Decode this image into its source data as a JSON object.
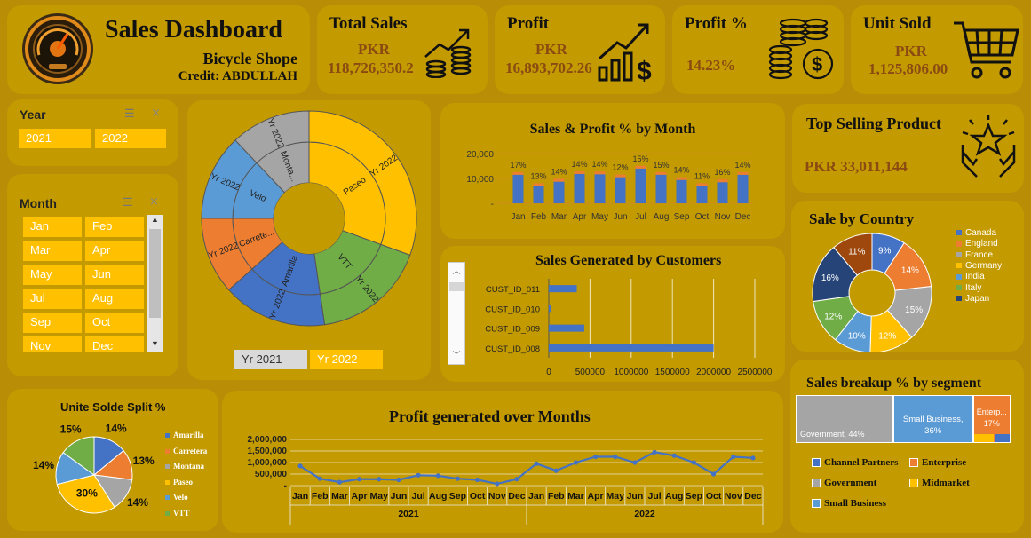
{
  "header": {
    "title": "Sales Dashboard",
    "subtitle": "Bicycle Shope",
    "credit": "Credit: ABDULLAH"
  },
  "kpis": [
    {
      "title": "Total Sales",
      "currency": "PKR",
      "value": "118,726,350.2"
    },
    {
      "title": "Profit",
      "currency": "PKR",
      "value": "16,893,702.26"
    },
    {
      "title": "Profit %",
      "currency": "",
      "value": "14.23%"
    },
    {
      "title": "Unit Sold",
      "currency": "PKR",
      "value": "1,125,806.00"
    }
  ],
  "year_slicer": {
    "title": "Year",
    "items": [
      "2021",
      "2022"
    ]
  },
  "month_slicer": {
    "title": "Month",
    "items": [
      "Jan",
      "Feb",
      "Mar",
      "Apr",
      "May",
      "Jun",
      "Jul",
      "Aug",
      "Sep",
      "Oct",
      "Nov",
      "Dec"
    ]
  },
  "sunburst_slicer": {
    "items": [
      "Yr 2021",
      "Yr 2022"
    ]
  },
  "top_product": {
    "title": "Top Selling Product",
    "value": "PKR 33,011,144"
  },
  "colors": {
    "blue": "#4472c4",
    "orange": "#ed7d31",
    "gray": "#a5a5a5",
    "yellow": "#ffc000",
    "lightblue": "#5b9bd5",
    "green": "#70ad47",
    "navy": "#264478",
    "brown": "#9e480e",
    "bg": "#b98d06",
    "card": "#c39a00",
    "accent_text": "#8a4a12"
  },
  "chart_data": [
    {
      "type": "sunburst",
      "title": "",
      "inner": [
        "Paseo",
        "VTT",
        "Amarilla",
        "Carrete...",
        "Velo",
        "Monta..."
      ],
      "outer_label": "Yr 2022",
      "outer": [
        {
          "product": "Paseo",
          "label": "Yr 2022"
        },
        {
          "product": "VTT",
          "label": "Yr 2022"
        },
        {
          "product": "Amarilla",
          "label": "Yr 2022"
        },
        {
          "product": "Carretera",
          "label": "Yr 2022"
        },
        {
          "product": "Velo",
          "label": "Yr 2022"
        },
        {
          "product": "Montana",
          "label": "Yr 2022"
        }
      ],
      "values": [
        33.0,
        18.5,
        17.0,
        12.5,
        14.0,
        13.0
      ]
    },
    {
      "type": "bar",
      "title": "Sales & Profit % by Month",
      "categories": [
        "Jan",
        "Feb",
        "Mar",
        "Apr",
        "May",
        "Jun",
        "Jul",
        "Aug",
        "Sep",
        "Oct",
        "Nov",
        "Dec"
      ],
      "values": [
        11500,
        7000,
        8700,
        11800,
        11700,
        10500,
        14000,
        11500,
        9400,
        7000,
        8500,
        11500
      ],
      "data_labels": [
        "17%",
        "13%",
        "14%",
        "14%",
        "14%",
        "12%",
        "15%",
        "15%",
        "14%",
        "11%",
        "16%",
        "14%"
      ],
      "yticks": [
        "20,000",
        "10,000",
        "-"
      ],
      "ylim": [
        0,
        20000
      ]
    },
    {
      "type": "bar",
      "title": "Sales Generated by Customers",
      "orientation": "horizontal",
      "categories": [
        "CUST_ID_011",
        "CUST_ID_010",
        "CUST_ID_009",
        "CUST_ID_008"
      ],
      "values": [
        340000,
        30000,
        430000,
        2000000
      ],
      "xticks": [
        "0",
        "500000",
        "1000000",
        "1500000",
        "2000000",
        "2500000"
      ],
      "xlim": [
        0,
        2500000
      ]
    },
    {
      "type": "pie",
      "title": "Sale by Country",
      "categories": [
        "Canada",
        "England",
        "France",
        "Germany",
        "India",
        "Italy",
        "Japan"
      ],
      "labels": [
        "9%",
        "14%",
        "15%",
        "12%",
        "10%",
        "12%",
        "16%",
        "11%"
      ],
      "values": [
        9,
        14,
        15,
        12,
        10,
        12,
        16,
        11
      ],
      "slice_colors": [
        "#4472c4",
        "#ed7d31",
        "#a5a5a5",
        "#ffc000",
        "#5b9bd5",
        "#70ad47",
        "#264478",
        "#9e480e"
      ]
    },
    {
      "type": "pie",
      "title": "Unite Solde Split %",
      "categories": [
        "Amarilla",
        "Carretera",
        "Montana",
        "Paseo",
        "Velo",
        "VTT"
      ],
      "values": [
        14,
        13,
        14,
        30,
        14,
        15
      ],
      "labels": [
        "14%",
        "13%",
        "14%",
        "30%",
        "14%",
        "15%"
      ]
    },
    {
      "type": "line",
      "title": "Profit generated over Months",
      "x": [
        "Jan",
        "Feb",
        "Mar",
        "Apr",
        "May",
        "Jun",
        "Jul",
        "Aug",
        "Sep",
        "Oct",
        "Nov",
        "Dec",
        "Jan",
        "Feb",
        "Mar",
        "Apr",
        "May",
        "Jun",
        "Jul",
        "Aug",
        "Sep",
        "Oct",
        "Nov",
        "Dec"
      ],
      "groups": [
        "2021",
        "2022"
      ],
      "values": [
        850000,
        300000,
        150000,
        280000,
        280000,
        250000,
        450000,
        430000,
        300000,
        250000,
        80000,
        280000,
        950000,
        650000,
        1000000,
        1250000,
        1250000,
        1000000,
        1450000,
        1300000,
        1000000,
        500000,
        1250000,
        1200000
      ],
      "yticks": [
        "2,000,000",
        "1,500,000",
        "1,000,000",
        "500,000",
        "-"
      ],
      "ylim": [
        0,
        2000000
      ]
    },
    {
      "type": "treemap",
      "title": "Sales breakup % by segment",
      "categories": [
        "Channel Partners",
        "Enterprise",
        "Government",
        "Midmarket",
        "Small Business"
      ],
      "tiles": [
        {
          "name": "Government",
          "label": "Government, 44%",
          "value": 44
        },
        {
          "name": "Small Business",
          "label": "Small Business, 36%",
          "value": 36
        },
        {
          "name": "Enterprise",
          "label": "Enterp... 17%",
          "value": 17
        }
      ]
    }
  ]
}
